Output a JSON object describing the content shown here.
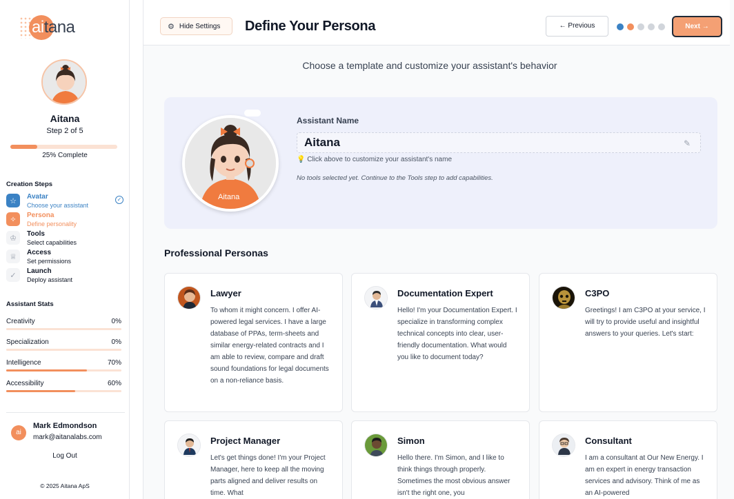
{
  "brand": {
    "logo_text_accent": "ai",
    "logo_text_rest": "tana"
  },
  "sidebar": {
    "assistant_name": "Aitana",
    "step_text": "Step 2 of 5",
    "progress": 0.25,
    "progress_label": "25% Complete",
    "creation_steps_heading": "Creation Steps",
    "steps": [
      {
        "title": "Avatar",
        "subtitle": "Choose your assistant",
        "icon": "star-icon",
        "state": "done"
      },
      {
        "title": "Persona",
        "subtitle": "Define personality",
        "icon": "sparkle-icon",
        "state": "current"
      },
      {
        "title": "Tools",
        "subtitle": "Select capabilities",
        "icon": "crown-icon",
        "state": "todo"
      },
      {
        "title": "Access",
        "subtitle": "Set permissions",
        "icon": "trophy-icon",
        "state": "todo"
      },
      {
        "title": "Launch",
        "subtitle": "Deploy assistant",
        "icon": "check-icon",
        "state": "todo"
      }
    ],
    "stats_heading": "Assistant Stats",
    "stats": [
      {
        "label": "Creativity",
        "value": "0%",
        "level": 0
      },
      {
        "label": "Specialization",
        "value": "0%",
        "level": 0
      },
      {
        "label": "Intelligence",
        "value": "70%",
        "level": 0.7
      },
      {
        "label": "Accessibility",
        "value": "60%",
        "level": 0.6
      }
    ],
    "user": {
      "initials": "ai",
      "name": "Mark Edmondson",
      "email": "mark@aitanalabs.com"
    },
    "logout_label": "Log Out",
    "copyright": "© 2025 Aitana ApS"
  },
  "header": {
    "hide_settings_label": "Hide Settings",
    "title": "Define Your Persona",
    "previous_label": "← Previous",
    "next_label": "Next →",
    "step_dots": 5,
    "current_dot": 1
  },
  "main": {
    "subtitle": "Choose a template and customize your assistant's behavior",
    "name_label": "Assistant Name",
    "name_value": "Aitana",
    "name_hint": "💡 Click above to customize your assistant's name",
    "tools_note": "No tools selected yet. Continue to the Tools step to add capabilities.",
    "section_title": "Professional Personas",
    "personas": [
      {
        "name": "Lawyer",
        "description": "To whom it might concern. I offer AI-powered legal services. I have a large database of PPAs, term-sheets and similar energy-related contracts and I am able to review, compare and draft sound foundations for legal documents on a non-reliance basis."
      },
      {
        "name": "Documentation Expert",
        "description": "Hello! I'm your Documentation Expert. I specialize in transforming complex technical concepts into clear, user-friendly documentation. What would you like to document today?"
      },
      {
        "name": "C3PO",
        "description": "Greetings! I am C3PO at your service, I will try to provide useful and insightful answers to your queries. Let's start:"
      },
      {
        "name": "Project Manager",
        "description": "Let's get things done! I'm your Project Manager, here to keep all the moving parts aligned and deliver results on time. What"
      },
      {
        "name": "Simon",
        "description": "Hello there. I'm Simon, and I like to think things through properly. Sometimes the most obvious answer isn't the right one, you"
      },
      {
        "name": "Consultant",
        "description": "I am a consultant at Our New Energy. I am en expert in energy transaction services and advisory. Think of me as an AI-powered"
      }
    ]
  },
  "colors": {
    "accent": "#f28f5d",
    "accent_light": "#fbe2d4",
    "done_blue": "#3b82c4",
    "panel": "#eef0fb"
  }
}
